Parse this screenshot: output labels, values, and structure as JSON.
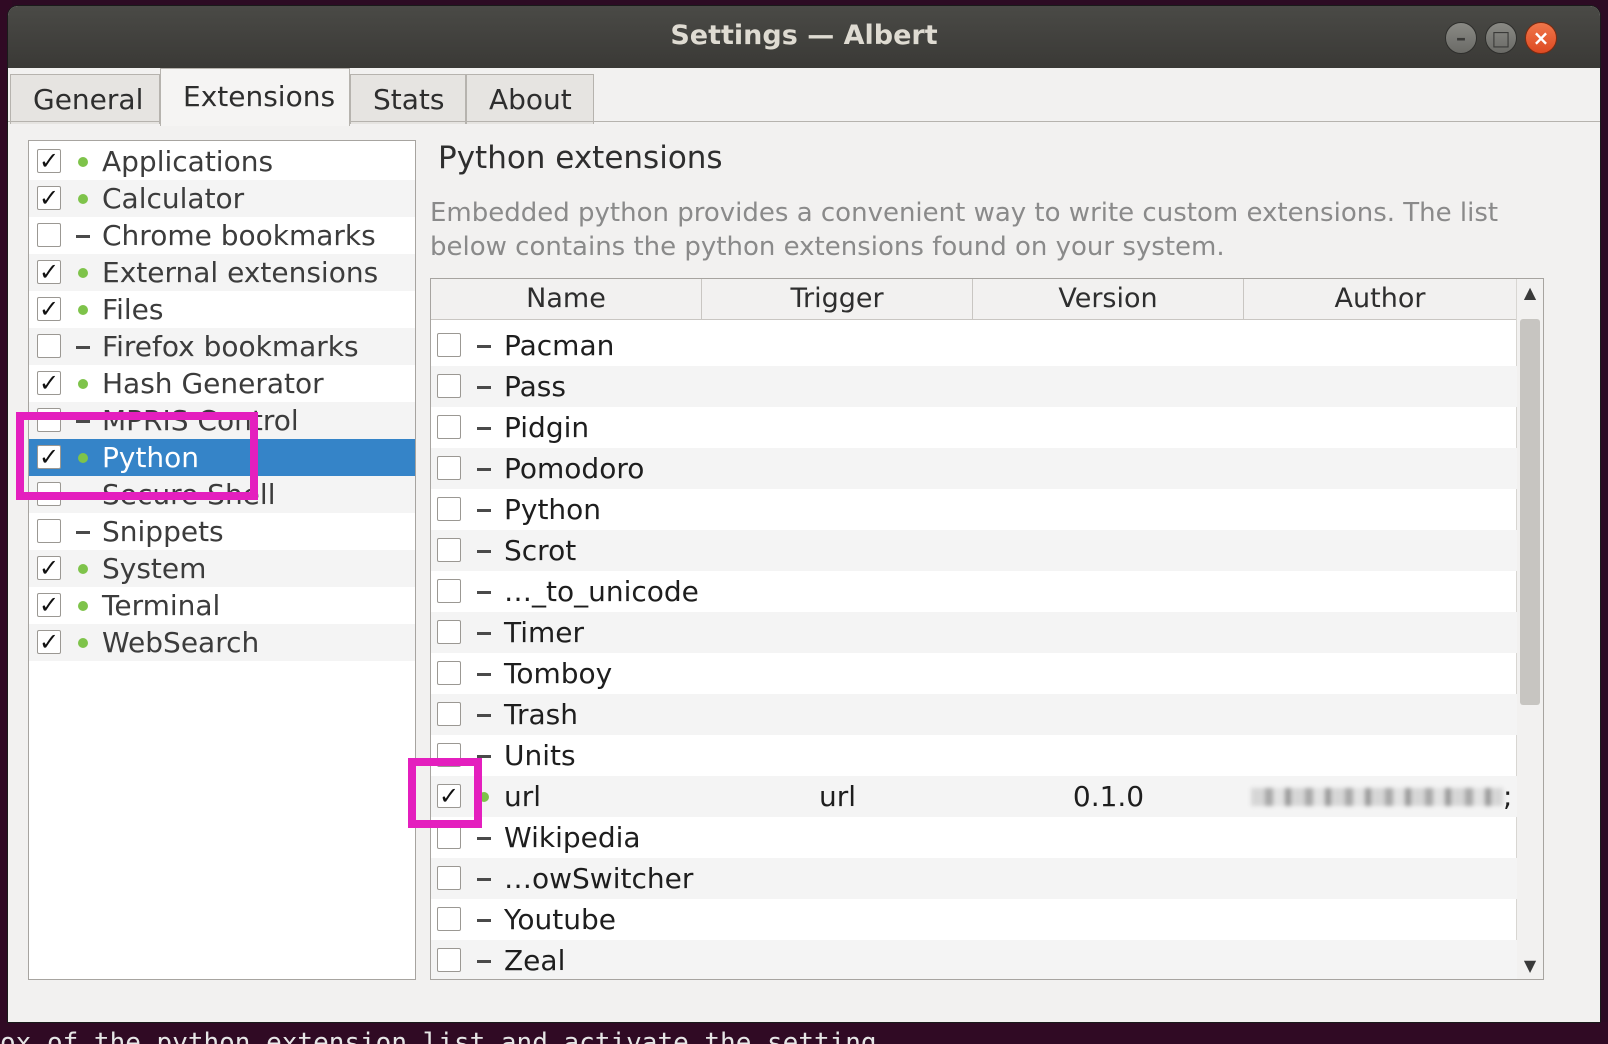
{
  "window": {
    "title": "Settings — Albert",
    "controls": [
      "minimize-icon",
      "maximize-icon",
      "close-icon"
    ]
  },
  "tabs": [
    {
      "label": "General"
    },
    {
      "label": "Extensions",
      "active": true
    },
    {
      "label": "Stats"
    },
    {
      "label": "About"
    }
  ],
  "extensions": [
    {
      "label": "Applications",
      "checked": true,
      "loaded": true
    },
    {
      "label": "Calculator",
      "checked": true,
      "loaded": true
    },
    {
      "label": "Chrome bookmarks",
      "checked": false,
      "loaded": false
    },
    {
      "label": "External extensions",
      "checked": true,
      "loaded": true
    },
    {
      "label": "Files",
      "checked": true,
      "loaded": true
    },
    {
      "label": "Firefox bookmarks",
      "checked": false,
      "loaded": false
    },
    {
      "label": "Hash Generator",
      "checked": true,
      "loaded": true
    },
    {
      "label": "MPRIS Control",
      "checked": false,
      "loaded": false
    },
    {
      "label": "Python",
      "checked": true,
      "loaded": true,
      "selected": true
    },
    {
      "label": "Secure Shell",
      "checked": false,
      "loaded": false
    },
    {
      "label": "Snippets",
      "checked": false,
      "loaded": false
    },
    {
      "label": "System",
      "checked": true,
      "loaded": true
    },
    {
      "label": "Terminal",
      "checked": true,
      "loaded": true
    },
    {
      "label": "WebSearch",
      "checked": true,
      "loaded": true
    }
  ],
  "python": {
    "title": "Python extensions",
    "description": "Embedded python provides a convenient way to write custom extensions. The list below contains the python extensions found on your system.",
    "columns": [
      "Name",
      "Trigger",
      "Version",
      "Author"
    ],
    "rows": [
      {
        "name": "Pacman",
        "checked": false,
        "loaded": false,
        "trigger": "",
        "version": ""
      },
      {
        "name": "Pass",
        "checked": false,
        "loaded": false,
        "trigger": "",
        "version": ""
      },
      {
        "name": "Pidgin",
        "checked": false,
        "loaded": false,
        "trigger": "",
        "version": ""
      },
      {
        "name": "Pomodoro",
        "checked": false,
        "loaded": false,
        "trigger": "",
        "version": ""
      },
      {
        "name": "Python",
        "checked": false,
        "loaded": false,
        "trigger": "",
        "version": ""
      },
      {
        "name": "Scrot",
        "checked": false,
        "loaded": false,
        "trigger": "",
        "version": ""
      },
      {
        "name": "…_to_unicode",
        "checked": false,
        "loaded": false,
        "trigger": "",
        "version": ""
      },
      {
        "name": "Timer",
        "checked": false,
        "loaded": false,
        "trigger": "",
        "version": ""
      },
      {
        "name": "Tomboy",
        "checked": false,
        "loaded": false,
        "trigger": "",
        "version": ""
      },
      {
        "name": "Trash",
        "checked": false,
        "loaded": false,
        "trigger": "",
        "version": ""
      },
      {
        "name": "Units",
        "checked": false,
        "loaded": false,
        "trigger": "",
        "version": ""
      },
      {
        "name": "url",
        "checked": true,
        "loaded": true,
        "trigger": "url",
        "version": "0.1.0",
        "author_suffix": ";"
      },
      {
        "name": "Wikipedia",
        "checked": false,
        "loaded": false,
        "trigger": "",
        "version": ""
      },
      {
        "name": "…owSwitcher",
        "checked": false,
        "loaded": false,
        "trigger": "",
        "version": ""
      },
      {
        "name": "Youtube",
        "checked": false,
        "loaded": false,
        "trigger": "",
        "version": ""
      },
      {
        "name": "Zeal",
        "checked": false,
        "loaded": false,
        "trigger": "",
        "version": ""
      }
    ]
  },
  "terminal_bottom": "ox of the python extension list and activate the setting",
  "highlight_color": "#e41fbe",
  "selection_color": "#3584c8",
  "loaded_color": "#7ec34a"
}
